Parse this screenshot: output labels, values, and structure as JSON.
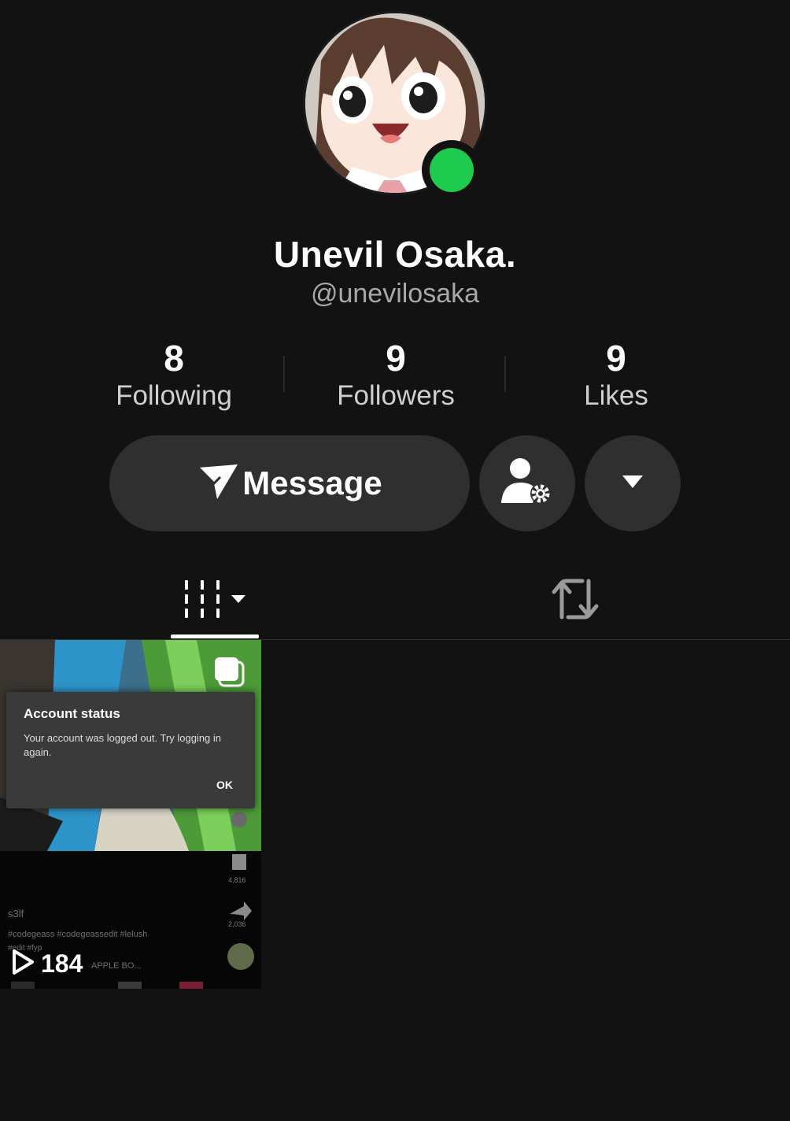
{
  "profile": {
    "display_name": "Unevil Osaka.",
    "handle": "@unevilosaka",
    "online_color": "#1ecb4f"
  },
  "stats": [
    {
      "value": "8",
      "label": "Following"
    },
    {
      "value": "9",
      "label": "Followers"
    },
    {
      "value": "9",
      "label": "Likes"
    }
  ],
  "actions": {
    "message_label": "Message",
    "message_icon": "send-icon",
    "friends_icon": "person-settings-icon",
    "more_icon": "caret-down-icon"
  },
  "tabs": [
    {
      "id": "videos",
      "icon": "grid-columns-icon",
      "has_dropdown": true,
      "active": true
    },
    {
      "id": "reposts",
      "icon": "repost-icon",
      "active": false
    }
  ],
  "video": {
    "views": "184",
    "dialog": {
      "title": "Account status",
      "body": "Your account was logged out. Try logging in again.",
      "ok_label": "OK"
    },
    "side_counts": [
      "4,816",
      "2,036"
    ],
    "caption_user": "s3lf",
    "caption_tags": "#codegeass #codegeassedit #lelush",
    "caption_more": "#edit #fyp",
    "music": "APPLE BO..."
  }
}
